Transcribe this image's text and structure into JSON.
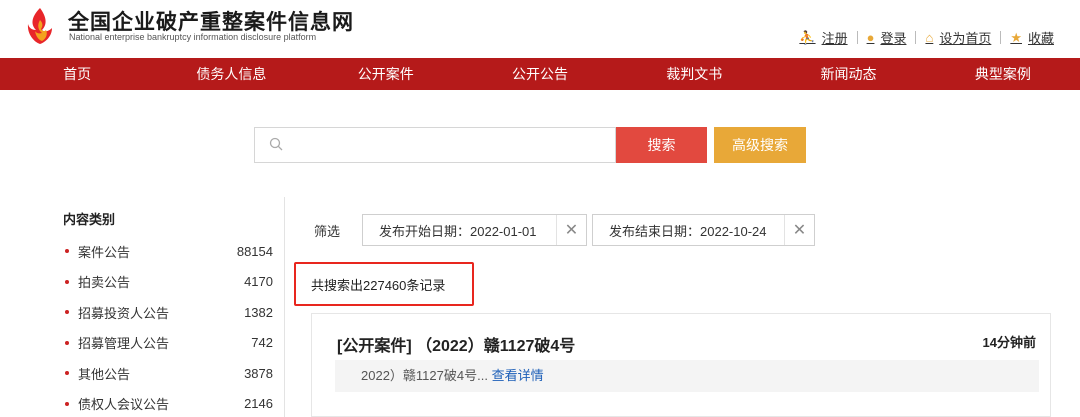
{
  "header": {
    "title_cn": "全国企业破产重整案件信息网",
    "title_en": "National enterprise bankruptcy  information disclosure platform",
    "links": [
      {
        "label": "注册",
        "icon": "person-icon",
        "glyph": "⚔",
        "color": "#e8a838"
      },
      {
        "label": "登录",
        "icon": "lock-icon",
        "glyph": "●",
        "color": "#e8a838"
      },
      {
        "label": "设为首页",
        "icon": "home-icon",
        "glyph": "⌂",
        "color": "#e8a838"
      },
      {
        "label": "收藏",
        "icon": "star-icon",
        "glyph": "★",
        "color": "#e8a838"
      }
    ]
  },
  "nav": {
    "items": [
      "首页",
      "债务人信息",
      "公开案件",
      "公开公告",
      "裁判文书",
      "新闻动态",
      "典型案例"
    ],
    "bg_color": "#b51a1a"
  },
  "search": {
    "value": "",
    "placeholder": "",
    "search_label": "搜索",
    "advanced_label": "高级搜索"
  },
  "sidebar": {
    "title": "内容类别",
    "categories": [
      {
        "label": "案件公告",
        "count": "88154"
      },
      {
        "label": "拍卖公告",
        "count": "4170"
      },
      {
        "label": "招募投资人公告",
        "count": "1382"
      },
      {
        "label": "招募管理人公告",
        "count": "742"
      },
      {
        "label": "其他公告",
        "count": "3878"
      },
      {
        "label": "债权人会议公告",
        "count": "2146"
      }
    ]
  },
  "filters": {
    "label": "筛选",
    "start_date": "发布开始日期：2022-01-01",
    "end_date": "发布结束日期：2022-10-24"
  },
  "results": {
    "count_text": "共搜索出227460条记录",
    "items": [
      {
        "title": "[公开案件] （2022）赣1127破4号",
        "time": "14分钟前",
        "snippet": "2022）赣1127破4号...",
        "more": "查看详情"
      }
    ]
  }
}
